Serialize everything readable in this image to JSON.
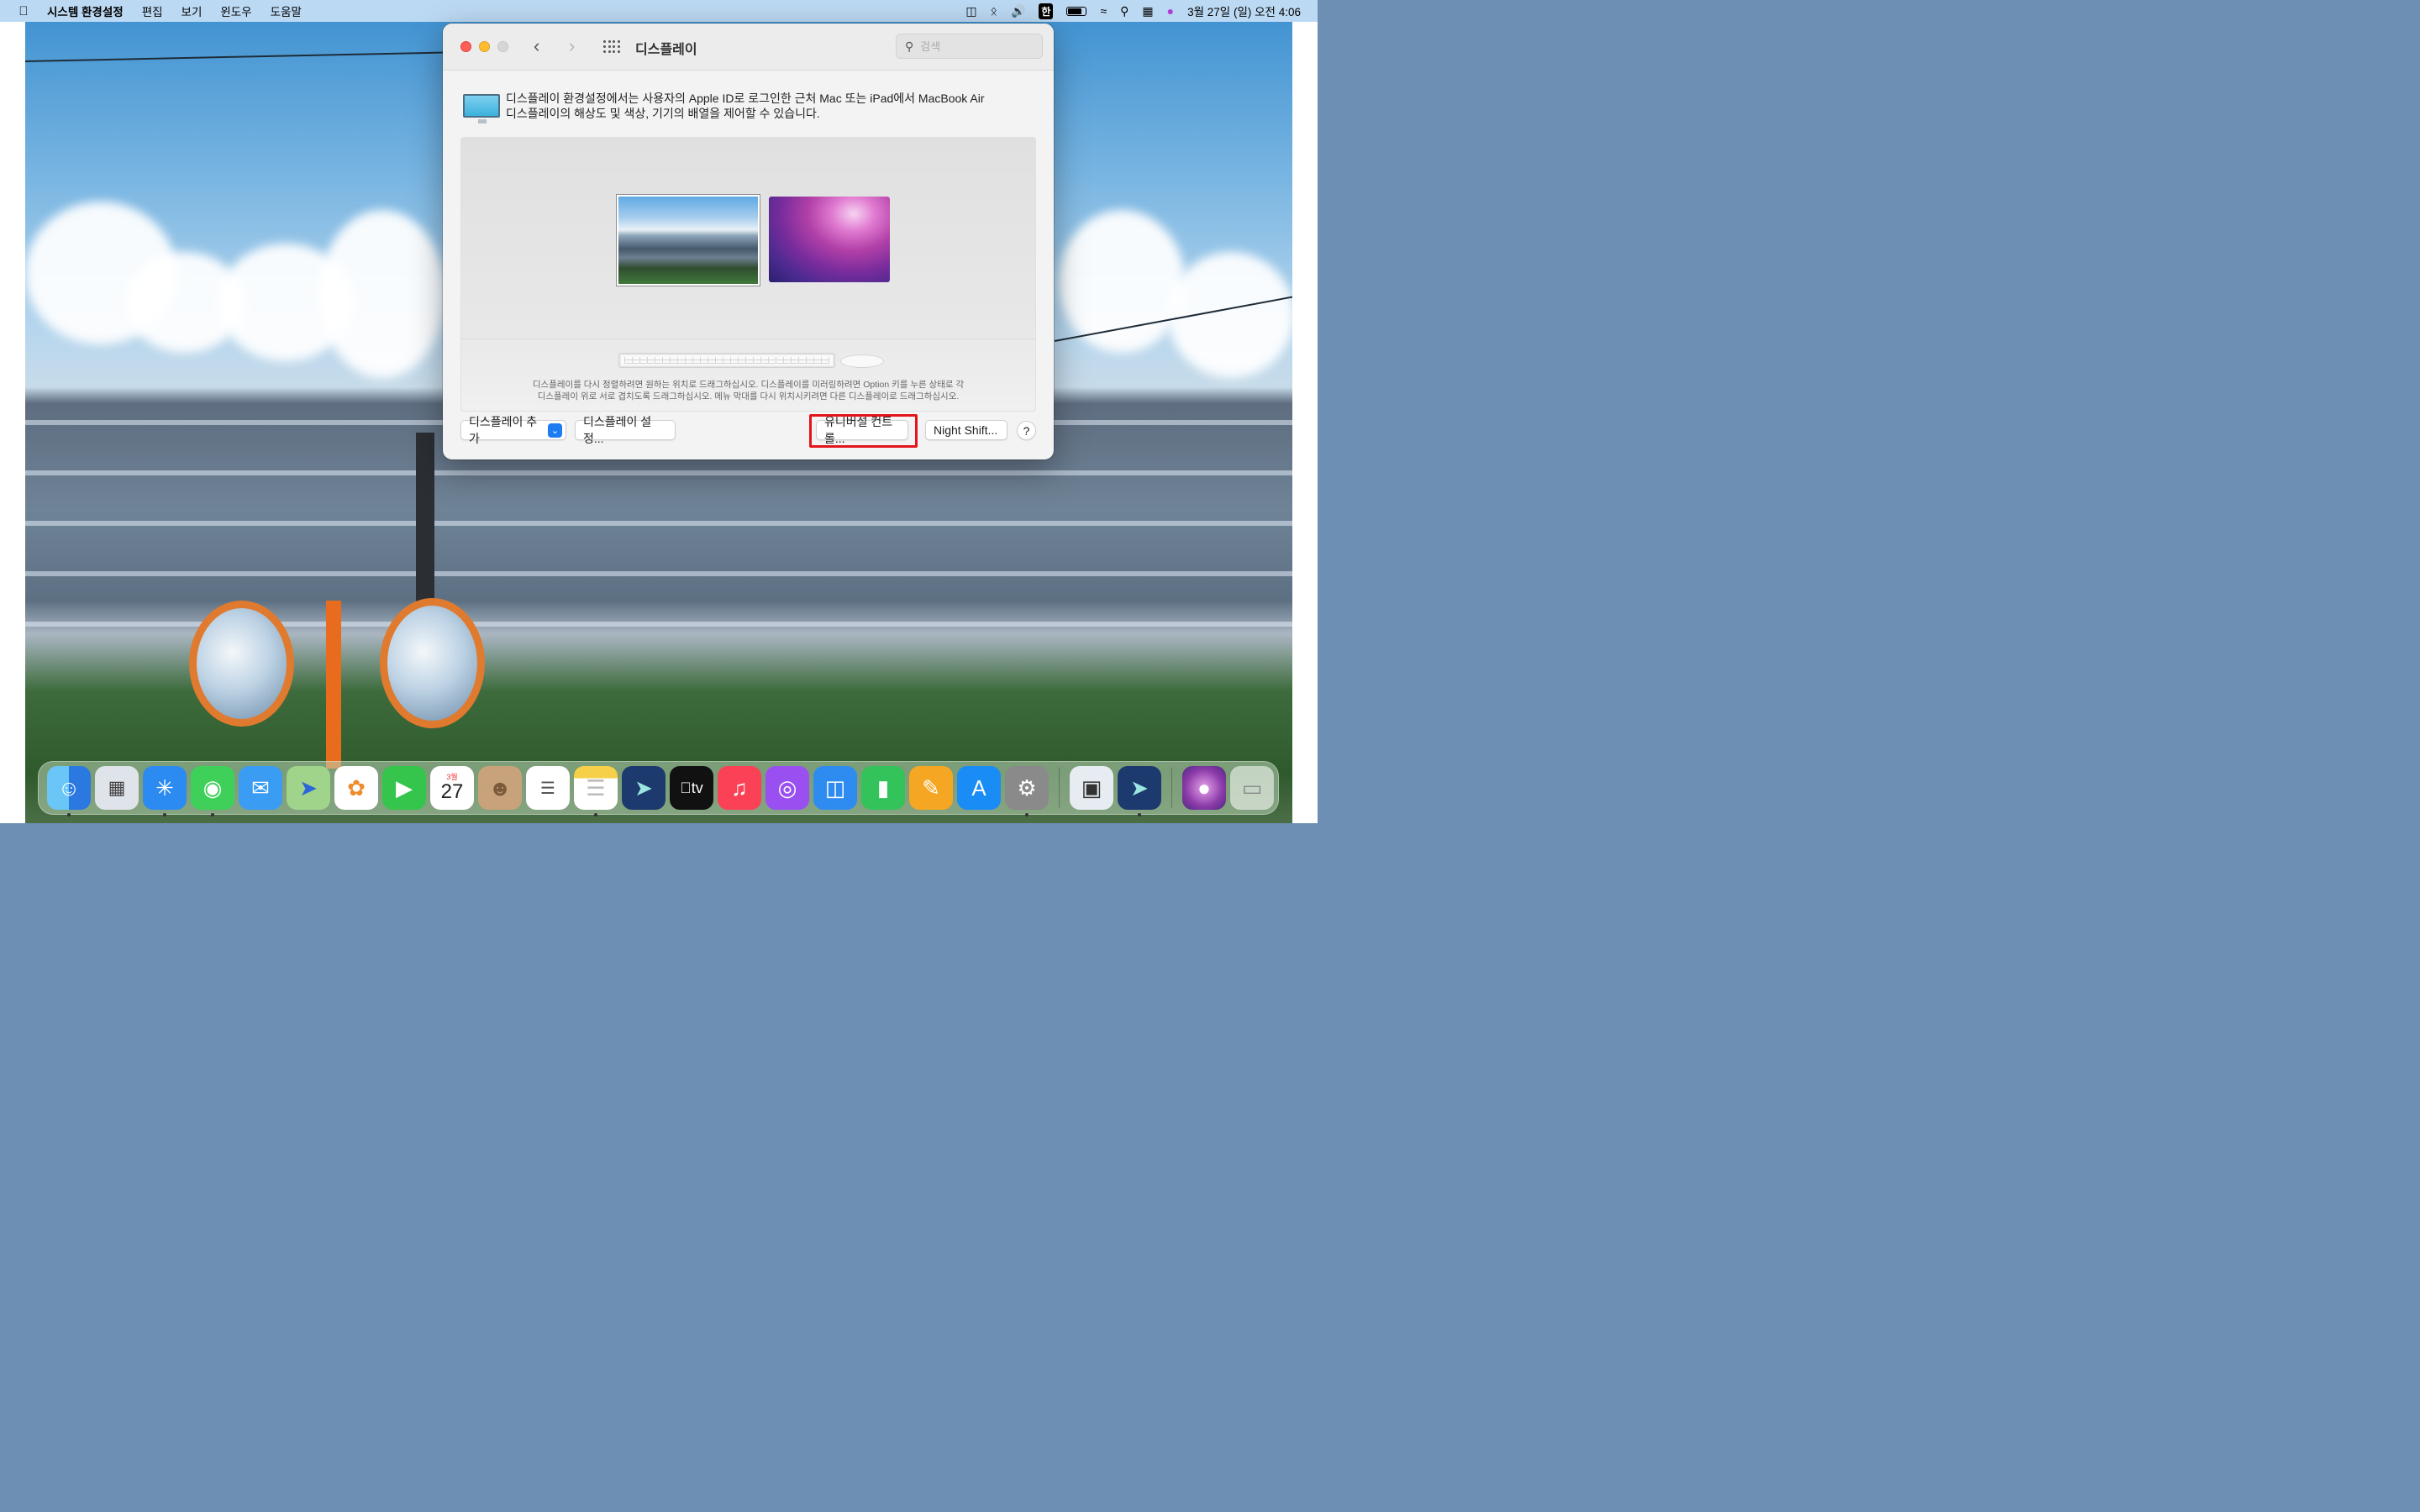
{
  "menubar": {
    "apple_icon": "apple-logo-icon",
    "app_name": "시스템 환경설정",
    "menus": [
      "편집",
      "보기",
      "윈도우",
      "도움말"
    ],
    "status_icons": [
      "display-mirroring-icon",
      "bluetooth-icon",
      "volume-icon",
      "input-source-icon",
      "battery-icon",
      "wifi-icon",
      "spotlight-search-icon",
      "control-center-icon",
      "siri-icon"
    ],
    "input_source": "한",
    "datetime": "3월 27일 (일) 오전 4:06"
  },
  "window": {
    "title": "디스플레이",
    "search_placeholder": "검색",
    "info_text_line1": "디스플레이 환경설정에서는 사용자의 Apple ID로 로그인한 근처 Mac 또는 iPad에서 MacBook Air",
    "info_text_line2": "디스플레이의 해상도 및 색상, 기기의 배열을 제어할 수 있습니다.",
    "hint_line1": "디스플레이를 다시 정렬하려면 원하는 위치로 드래그하십시오. 디스플레이를 미러링하려면 Option 키를 누른 상태로 각",
    "hint_line2": "디스플레이 위로 서로 겹치도록 드래그하십시오. 메뉴 막대를 다시 위치시키려면 다른 디스플레이로 드래그하십시오.",
    "buttons": {
      "add_display": "디스플레이 추가",
      "display_settings": "디스플레이 설정...",
      "universal_control": "유니버설 컨트롤...",
      "night_shift": "Night Shift...",
      "help": "?"
    },
    "highlight_color": "#e3141b"
  },
  "dock": {
    "calendar_month": "3월",
    "calendar_day": "27",
    "apps": [
      "Finder",
      "Launchpad",
      "Safari",
      "메시지",
      "Mail",
      "지도",
      "사진",
      "FaceTime",
      "캘린더",
      "연락처",
      "미리 알림",
      "메모",
      "Sidecar",
      "TV",
      "음악",
      "팟캐스트",
      "Keynote",
      "Numbers",
      "Pages",
      "App Store",
      "시스템 환경설정",
      "미리보기",
      "Sidecar",
      "macOS Monterey",
      "휴지통"
    ]
  }
}
